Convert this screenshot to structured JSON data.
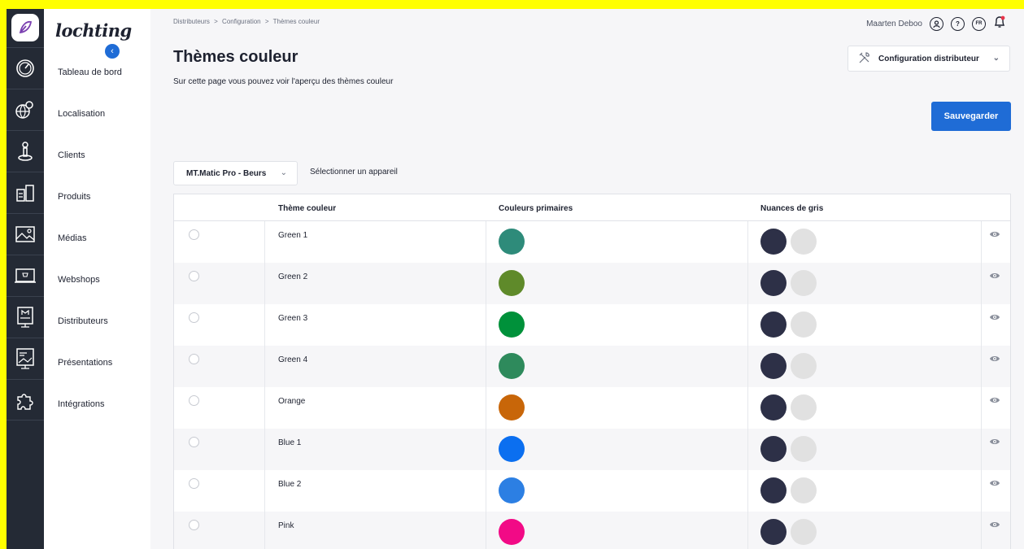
{
  "app": {
    "brand": "lochting"
  },
  "nav": {
    "items": [
      {
        "label": "Tableau de bord",
        "icon": "dashboard-icon"
      },
      {
        "label": "Localisation",
        "icon": "globe-pin-icon"
      },
      {
        "label": "Clients",
        "icon": "person-pin-icon"
      },
      {
        "label": "Produits",
        "icon": "products-icon"
      },
      {
        "label": "Médias",
        "icon": "image-icon"
      },
      {
        "label": "Webshops",
        "icon": "webshop-icon"
      },
      {
        "label": "Distributeurs",
        "icon": "distributor-icon"
      },
      {
        "label": "Présentations",
        "icon": "presentation-icon"
      },
      {
        "label": "Intégrations",
        "icon": "puzzle-icon"
      }
    ]
  },
  "breadcrumb": {
    "items": [
      "Distributeurs",
      "Configuration",
      "Thèmes couleur"
    ],
    "separator": ">"
  },
  "user": {
    "name": "Maarten Deboo",
    "lang": "FR"
  },
  "page": {
    "title": "Thèmes couleur",
    "subtitle": "Sur cette page vous pouvez voir l'aperçu des thèmes couleur"
  },
  "config_dropdown": {
    "label": "Configuration distributeur"
  },
  "save_button": {
    "label": "Sauvegarder"
  },
  "device": {
    "selected": "MT.Matic Pro - Beurs",
    "label": "Sélectionner un appareil"
  },
  "table": {
    "headers": [
      "Thème couleur",
      "Couleurs primaires",
      "Nuances de gris"
    ],
    "rows": [
      {
        "name": "Green 1",
        "primary": "#2e8b7a",
        "grays": [
          "#2d3047",
          "#e1e1e1"
        ]
      },
      {
        "name": "Green 2",
        "primary": "#5f8a2a",
        "grays": [
          "#2d3047",
          "#e1e1e1"
        ]
      },
      {
        "name": "Green 3",
        "primary": "#00913a",
        "grays": [
          "#2d3047",
          "#e1e1e1"
        ]
      },
      {
        "name": "Green 4",
        "primary": "#2e8a5c",
        "grays": [
          "#2d3047",
          "#e1e1e1"
        ]
      },
      {
        "name": "Orange",
        "primary": "#c86609",
        "grays": [
          "#2d3047",
          "#e1e1e1"
        ]
      },
      {
        "name": "Blue 1",
        "primary": "#0b6ff0",
        "grays": [
          "#2d3047",
          "#e1e1e1"
        ]
      },
      {
        "name": "Blue 2",
        "primary": "#2c7fe3",
        "grays": [
          "#2d3047",
          "#e1e1e1"
        ]
      },
      {
        "name": "Pink",
        "primary": "#f20a86",
        "grays": [
          "#2d3047",
          "#e1e1e1"
        ]
      }
    ]
  },
  "colors": {
    "accent": "#1f6cd6",
    "rail": "#242a35"
  }
}
